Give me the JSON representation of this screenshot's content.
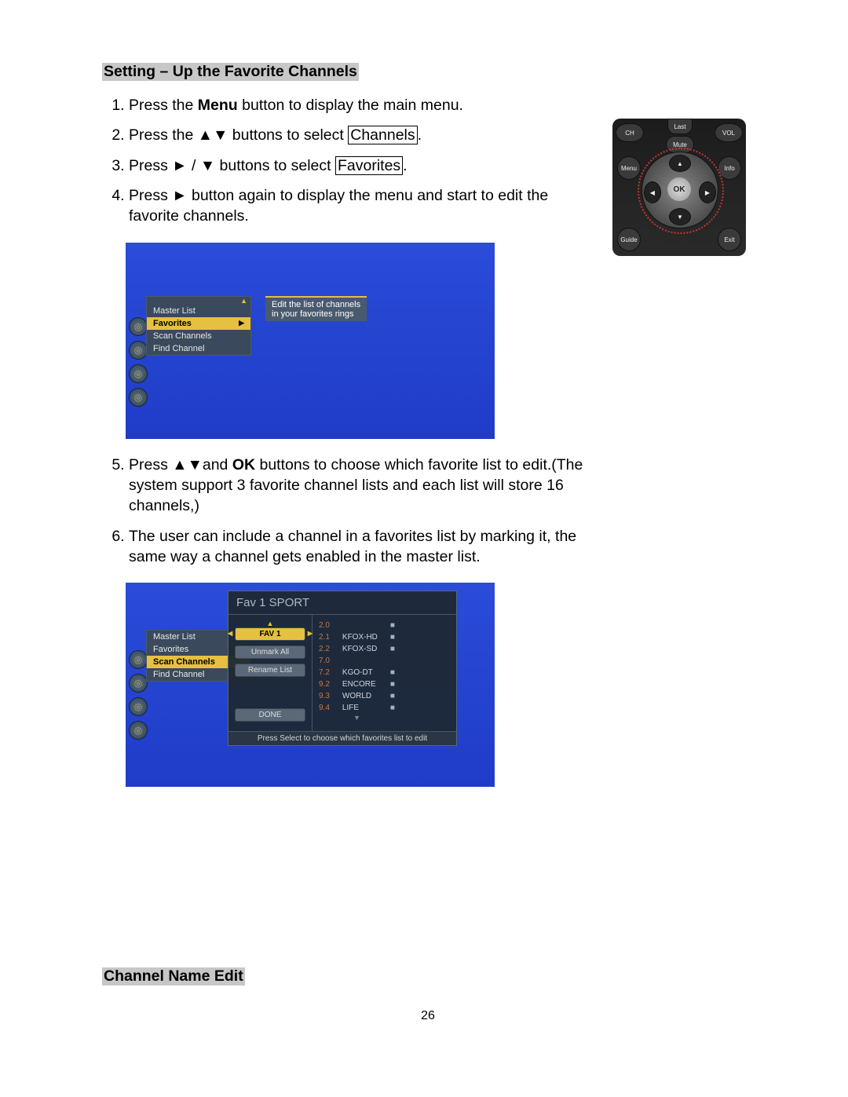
{
  "heading1": "Setting – Up the Favorite Channels",
  "steps": {
    "s1a": "Press the ",
    "s1b": "Menu",
    "s1c": " button to display the main menu.",
    "s2a": "Press the ▲▼ buttons to select ",
    "s2b": "Channels",
    "s2c": ".",
    "s3a": "Press ► / ▼ buttons to select ",
    "s3b": "Favorites",
    "s3c": ".",
    "s4": "Press ► button again to display the menu and start to edit the favorite channels.",
    "s5a": "Press ▲▼and ",
    "s5b": "OK",
    "s5c": " buttons to choose which favorite list to edit.(The system support 3 favorite channel lists and each list will store 16 channels,)",
    "s6": "The user can include a channel in a favorites list by marking it, the same way a channel gets enabled in the master list."
  },
  "remote": {
    "ch": "CH",
    "vol": "VOL",
    "last": "Last",
    "mute": "Mute",
    "menu": "Menu",
    "info": "Info",
    "guide": "Guide",
    "exit": "Exit",
    "ok": "OK",
    "up": "▲",
    "down": "▼",
    "left": "◀",
    "right": "▶"
  },
  "tv1": {
    "menu_items": {
      "m0": "Master List",
      "m1": "Favorites",
      "m2": "Scan Channels",
      "m3": "Find Channel"
    },
    "tooltip_l1": "Edit the list of channels",
    "tooltip_l2": "in your favorites rings",
    "arrow": "▶"
  },
  "tv2": {
    "menu_items": {
      "m0": "Master List",
      "m1": "Favorites",
      "m2": "Scan Channels",
      "m3": "Find Channel"
    },
    "popup_title": "Fav 1 SPORT",
    "left_buttons": {
      "b0": "FAV 1",
      "b1": "Unmark All",
      "b2": "Rename List",
      "b3": "DONE"
    },
    "channels": [
      {
        "num": "2.0",
        "name": "",
        "chk": "■"
      },
      {
        "num": "2.1",
        "name": "KFOX-HD",
        "chk": "■"
      },
      {
        "num": "2.2",
        "name": "KFOX-SD",
        "chk": "■"
      },
      {
        "num": "7.0",
        "name": "",
        "chk": ""
      },
      {
        "num": "7.2",
        "name": "KGO-DT",
        "chk": "■"
      },
      {
        "num": "9.2",
        "name": "ENCORE",
        "chk": "■"
      },
      {
        "num": "9.3",
        "name": "WORLD",
        "chk": "■"
      },
      {
        "num": "9.4",
        "name": "LIFE",
        "chk": "■"
      }
    ],
    "footer": "Press Select to choose which favorites list to edit"
  },
  "heading2": "Channel Name Edit",
  "page_number": "26"
}
